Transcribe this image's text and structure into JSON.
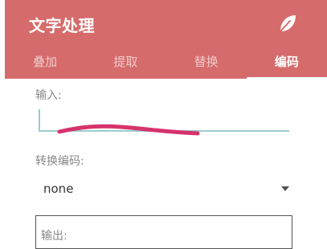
{
  "app_bar": {
    "title": "文字处理",
    "icon": "leaf-icon",
    "color": "#d66b6b"
  },
  "tabs": [
    {
      "label": "叠加",
      "active": false
    },
    {
      "label": "提取",
      "active": false
    },
    {
      "label": "替换",
      "active": false
    },
    {
      "label": "编码",
      "active": true
    }
  ],
  "form": {
    "input_label": "输入:",
    "input_value": "",
    "encoding_label": "转换编码:",
    "encoding_selected": "none",
    "output_label": "输出:"
  },
  "colors": {
    "accent": "#9ccccc",
    "scribble": "#d6336c"
  }
}
